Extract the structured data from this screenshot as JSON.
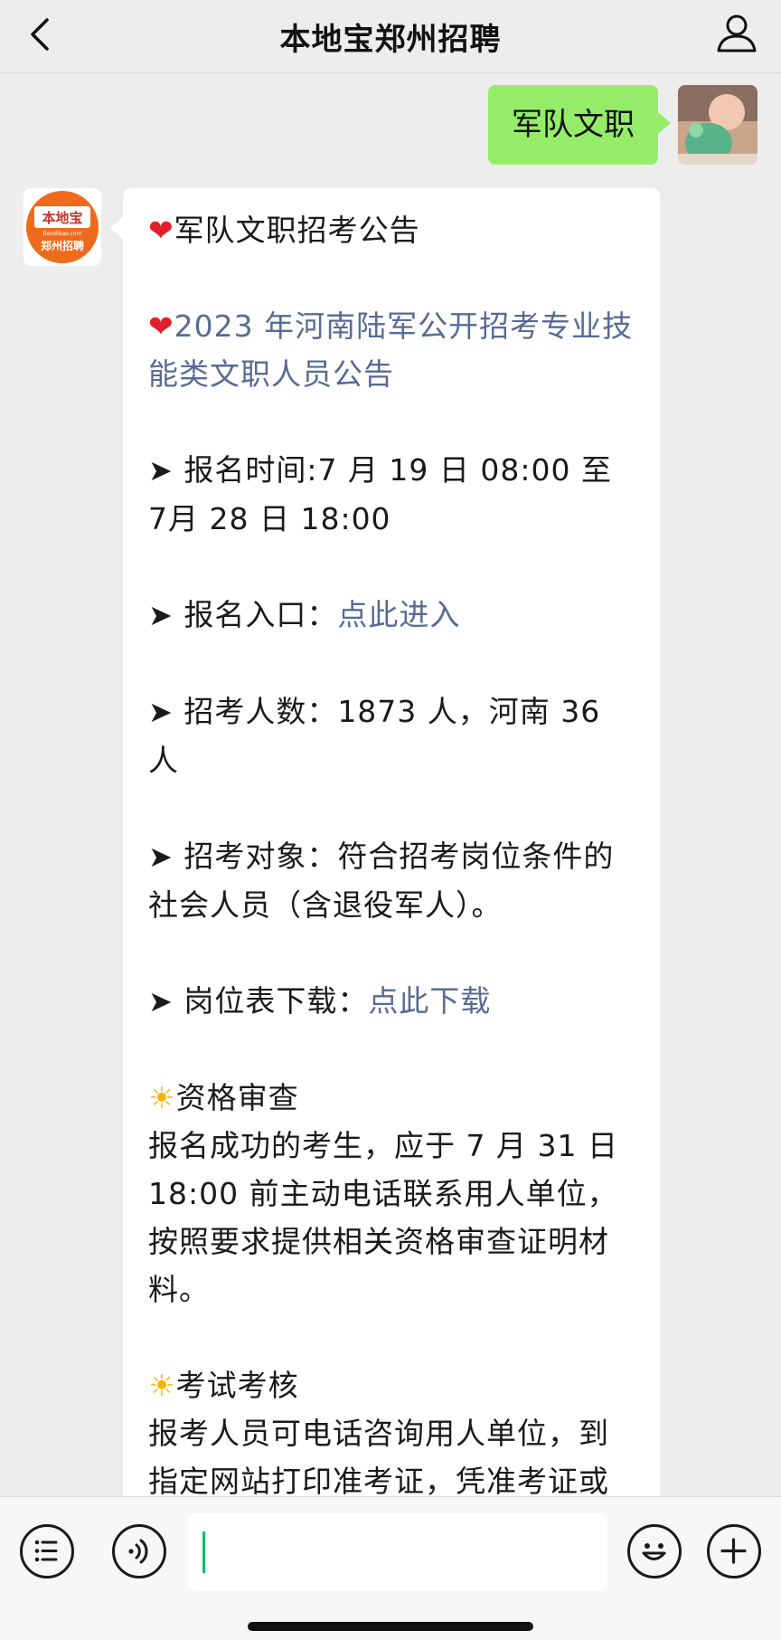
{
  "header": {
    "title": "本地宝郑州招聘"
  },
  "my_message": {
    "text": "军队文职"
  },
  "bot_avatar": {
    "logo_top": "本地宝",
    "logo_sub": "Bendibao.com",
    "logo_bottom": "郑州招聘",
    "brand_color": "#ef6a1b"
  },
  "reply": {
    "heading": "军队文职招考公告",
    "notice_title": "2023 年河南陆军公开招考专业技能类文职人员公告",
    "reg_time_label": "报名时间:",
    "reg_time_value": "7 月 19 日 08:00 至 7月 28 日 18:00",
    "reg_entry_label": "报名入口：",
    "reg_entry_link": "点此进入",
    "count_label": "招考人数：",
    "count_value": "1873 人，河南 36 人",
    "target_label": "招考对象：",
    "target_value": "符合招考岗位条件的社会人员（含退役军人）。",
    "table_label": "岗位表下载：",
    "table_link": "点此下载",
    "qual_heading": "资格审查",
    "qual_text": "报名成功的考生，应于 7 月 31 日 18:00 前主动电话联系用人单位，按照要求提供相关资格审查证明材料。",
    "exam_heading": "考试考核",
    "exam_text": "报考人员可电话咨询用人单位，到指定网站打印准考证，凭准考证或"
  },
  "colors": {
    "link": "#576b95",
    "my_bubble": "#95ec69",
    "heart": "#e0202a",
    "sun": "#f7b500"
  },
  "icons": {
    "back": "chevron-left-icon",
    "profile": "person-icon",
    "menu": "list-icon",
    "voice": "voice-icon",
    "emoji": "smiley-icon",
    "more": "plus-icon"
  }
}
